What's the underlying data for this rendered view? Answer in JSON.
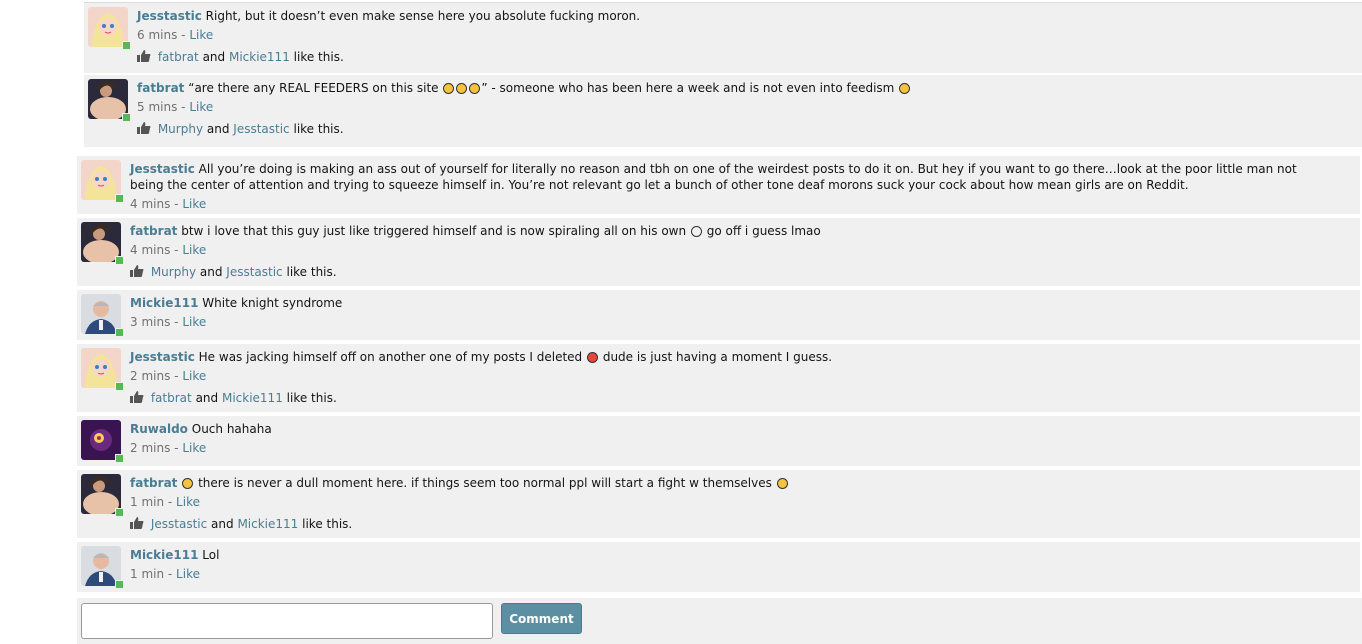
{
  "nested_replies": [
    {
      "author": "Jesstastic",
      "text": "Right, but it doesn’t even make sense here you absolute fucking moron.",
      "time": "6 mins",
      "like_label": "Like",
      "likes": {
        "user1": "fatbrat",
        "and": "and",
        "user2": "Mickie111",
        "suffix": "like this."
      }
    },
    {
      "author": "fatbrat",
      "text_before": "“are there any REAL FEEDERS on this site",
      "text_after": "” - someone who has been here a week and is not even into feedism",
      "time": "5 mins",
      "like_label": "Like",
      "likes": {
        "user1": "Murphy",
        "and": "and",
        "user2": "Jesstastic",
        "suffix": "like this."
      }
    }
  ],
  "comments": [
    {
      "author": "Jesstastic",
      "text": "All you’re doing is making an ass out of yourself for literally no reason and tbh on one of the weirdest posts to do it on. But hey if you want to go there…look at the poor little man not being the center of attention and trying to squeeze himself in. You’re not relevant go let a bunch of other tone deaf morons suck your cock about how mean girls are on Reddit.",
      "time": "4 mins",
      "like_label": "Like"
    },
    {
      "author": "fatbrat",
      "text_before": "btw i love that this guy just like triggered himself and is now spiraling all on his own",
      "text_after": "go off i guess lmao",
      "time": "4 mins",
      "like_label": "Like",
      "likes": {
        "user1": "Murphy",
        "and": "and",
        "user2": "Jesstastic",
        "suffix": "like this."
      }
    },
    {
      "author": "Mickie111",
      "text": "White knight syndrome",
      "time": "3 mins",
      "like_label": "Like"
    },
    {
      "author": "Jesstastic",
      "text_before": "He was jacking himself off on another one of my posts I deleted",
      "text_after": "dude is just having a moment I guess.",
      "time": "2 mins",
      "like_label": "Like",
      "likes": {
        "user1": "fatbrat",
        "and": "and",
        "user2": "Mickie111",
        "suffix": "like this."
      }
    },
    {
      "author": "Ruwaldo",
      "text": "Ouch hahaha",
      "time": "2 mins",
      "like_label": "Like"
    },
    {
      "author": "fatbrat",
      "text": "there is never a dull moment here. if things seem too normal ppl will start a fight w themselves",
      "time": "1 min",
      "like_label": "Like",
      "likes": {
        "user1": "Jesstastic",
        "and": "and",
        "user2": "Mickie111",
        "suffix": "like this."
      }
    },
    {
      "author": "Mickie111",
      "text": "Lol",
      "time": "1 min",
      "like_label": "Like"
    }
  ],
  "comment_form": {
    "button_label": "Comment"
  },
  "colors": {
    "link": "#4a7d93",
    "online": "#58b857",
    "button": "#5b8fa1",
    "row_bg": "#f0f0f0"
  },
  "icons": [
    "thumbs-up-icon",
    "online-indicator",
    "emoji-icon"
  ]
}
